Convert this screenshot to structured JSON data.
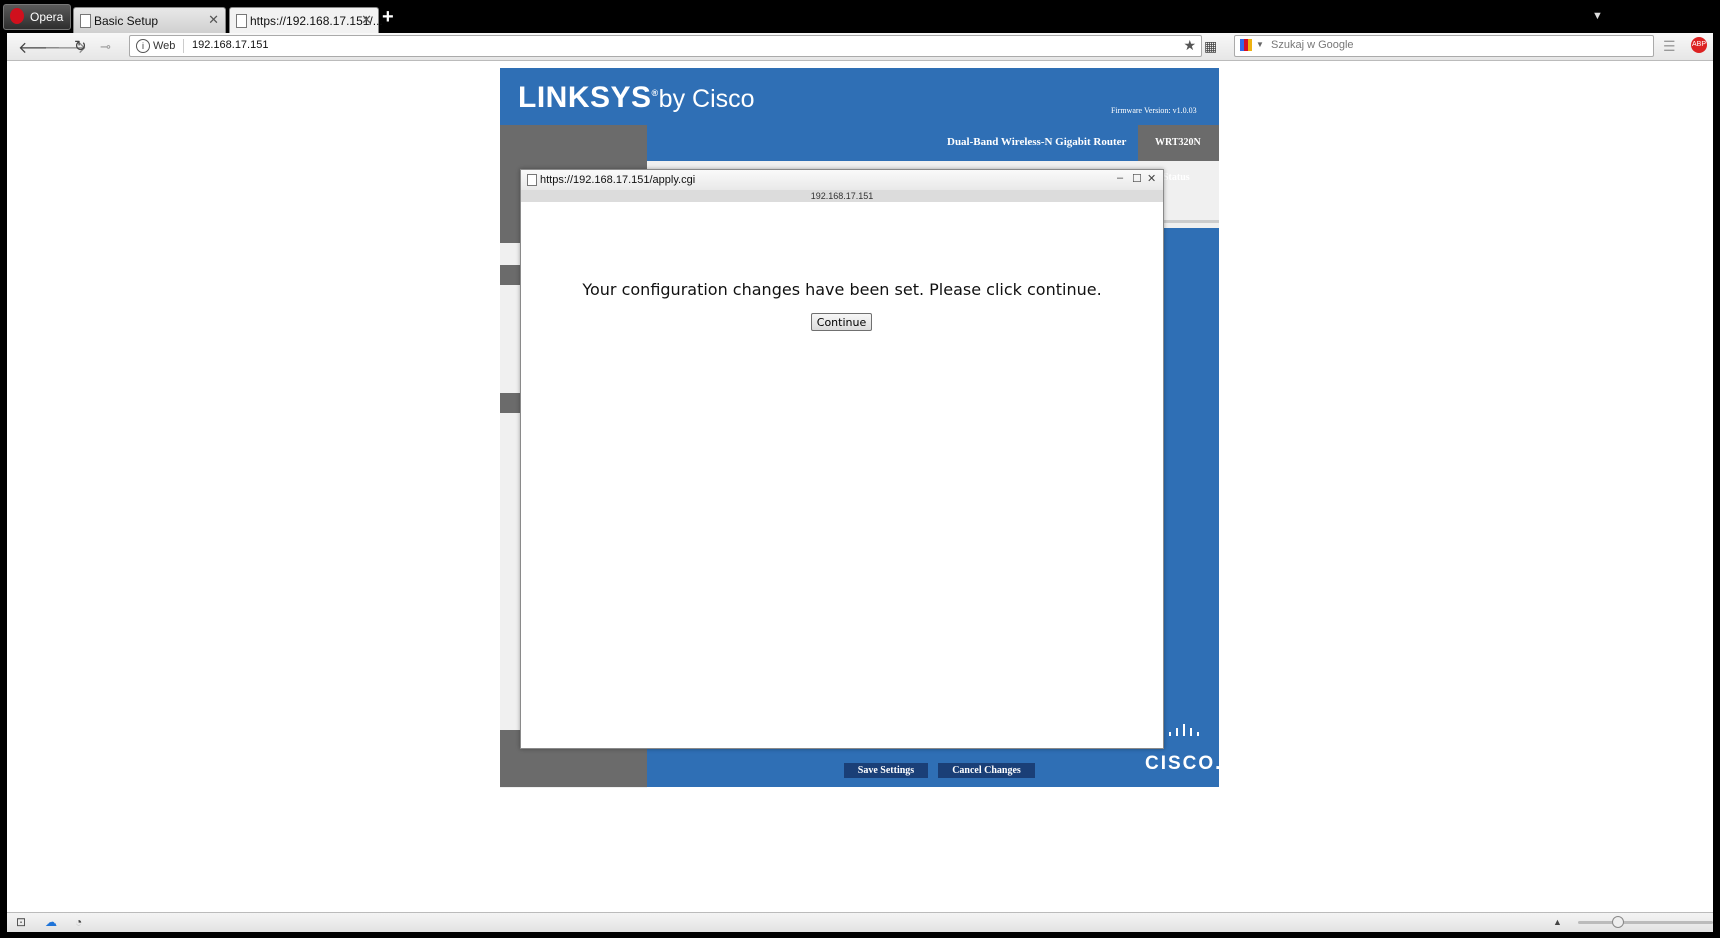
{
  "browser": {
    "menu_label": "Opera",
    "tabs": [
      {
        "label": "Basic Setup"
      },
      {
        "label": "https://192.168.17.151/..."
      }
    ],
    "new_tab_icon": "plus-icon",
    "web_label": "Web",
    "address": "192.168.17.151",
    "search_placeholder": "Szukaj w Google",
    "badge_text": "ABP"
  },
  "router": {
    "brand": "LINKSYS",
    "brand_suffix": "by Cisco",
    "firmware": "Firmware Version: v1.0.03",
    "product": "Dual-Band Wireless-N Gigabit Router",
    "model": "WRT320N",
    "status_tab": "Status",
    "save_button": "Save Settings",
    "cancel_button": "Cancel Changes",
    "cisco_word": "CISCO.",
    "colors": {
      "brand_blue": "#2f6fb5",
      "gray": "#6b6b6b",
      "button_navy": "#1a3f77"
    }
  },
  "popup": {
    "title": "https://192.168.17.151/apply.cgi",
    "host": "192.168.17.151",
    "message": "Your configuration changes have been set. Please click continue.",
    "continue_label": "Continue"
  }
}
